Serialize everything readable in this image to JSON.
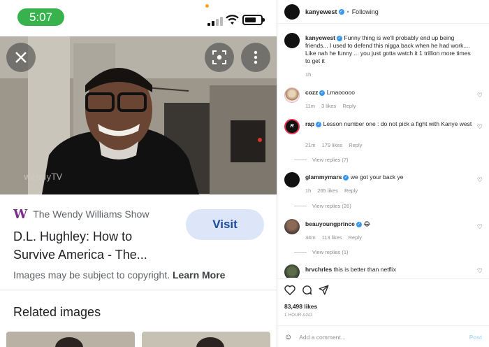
{
  "phone": {
    "status": {
      "time": "5:07"
    },
    "image": {
      "watermark": "wendyTV"
    },
    "result": {
      "source_icon_letter": "W",
      "source": "The Wendy Williams Show",
      "title_line1": "D.L. Hughley: How to",
      "title_line2": "Survive America - The...",
      "visit_label": "Visit",
      "copyright_text": "Images may be subject to copyright.",
      "learn_more": "Learn More"
    },
    "related_heading": "Related images"
  },
  "instagram": {
    "header": {
      "username": "kanyewest",
      "separator": "•",
      "follow_status": "Following"
    },
    "caption": {
      "username": "kanyewest",
      "text": "Funny thing is we'll probably end up being friends... I used to defend this nigga back when he had work.... Like nah he funny ... you just gotta watch it 1 trillion more times to get it",
      "time": "1h"
    },
    "comments": [
      {
        "username": "cozz",
        "text": "Lmaooooo",
        "time": "11m",
        "likes": "3 likes",
        "reply": "Reply",
        "view_replies": ""
      },
      {
        "username": "rap",
        "text": "Lesson number one : do not pick a fight with Kanye west",
        "time": "21m",
        "likes": "179 likes",
        "reply": "Reply",
        "view_replies": "View replies (7)"
      },
      {
        "username": "glammymars",
        "text": "we got your back ye",
        "time": "1h",
        "likes": "265 likes",
        "reply": "Reply",
        "view_replies": "View replies (26)"
      },
      {
        "username": "beauyoungprince",
        "text": "😂",
        "time": "34m",
        "likes": "113 likes",
        "reply": "Reply",
        "view_replies": "View replies (1)"
      },
      {
        "username": "hrvchrles",
        "text": "this is better than netflix"
      }
    ],
    "likes_count": "83,498 likes",
    "time_ago": "1 HOUR AGO",
    "add_comment_placeholder": "Add a comment...",
    "post_label": "Post",
    "colors": {
      "verified": "#3897f0",
      "post_disabled": "#b3dbff"
    }
  }
}
